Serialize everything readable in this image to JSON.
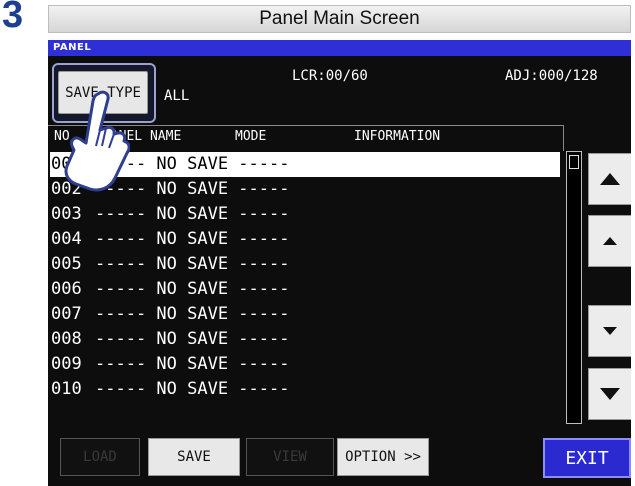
{
  "step": {
    "number": "3",
    "caption": "Panel Main Screen"
  },
  "screen": {
    "tab_label": "PANEL",
    "save_type_button": "SAVE TYPE",
    "save_type_value": "ALL",
    "lcr_counter": "LCR:00/60",
    "adj_counter": "ADJ:000/128",
    "columns": {
      "no": "NO.",
      "panel_name": "PANEL NAME",
      "mode": "MODE",
      "information": "INFORMATION"
    },
    "rows": [
      {
        "no": "001",
        "text": "----- NO SAVE -----",
        "selected": true
      },
      {
        "no": "002",
        "text": "----- NO SAVE -----"
      },
      {
        "no": "003",
        "text": "----- NO SAVE -----"
      },
      {
        "no": "004",
        "text": "----- NO SAVE -----"
      },
      {
        "no": "005",
        "text": "----- NO SAVE -----"
      },
      {
        "no": "006",
        "text": "----- NO SAVE -----"
      },
      {
        "no": "007",
        "text": "----- NO SAVE -----"
      },
      {
        "no": "008",
        "text": "----- NO SAVE -----"
      },
      {
        "no": "009",
        "text": "----- NO SAVE -----"
      },
      {
        "no": "010",
        "text": "----- NO SAVE -----"
      }
    ],
    "bottom_buttons": {
      "load": "LOAD",
      "save": "SAVE",
      "view": "VIEW",
      "option": "OPTION >>",
      "exit": "EXIT"
    },
    "scroll_buttons": [
      "page-up-arrow-icon",
      "line-up-arrow-icon",
      "line-down-arrow-icon",
      "page-down-arrow-icon"
    ],
    "colors": {
      "tab": "#2f2fd8",
      "exit": "#2a2ad0",
      "screen_bg": "#0d0d0d",
      "step_number": "#1d3f8f"
    }
  }
}
